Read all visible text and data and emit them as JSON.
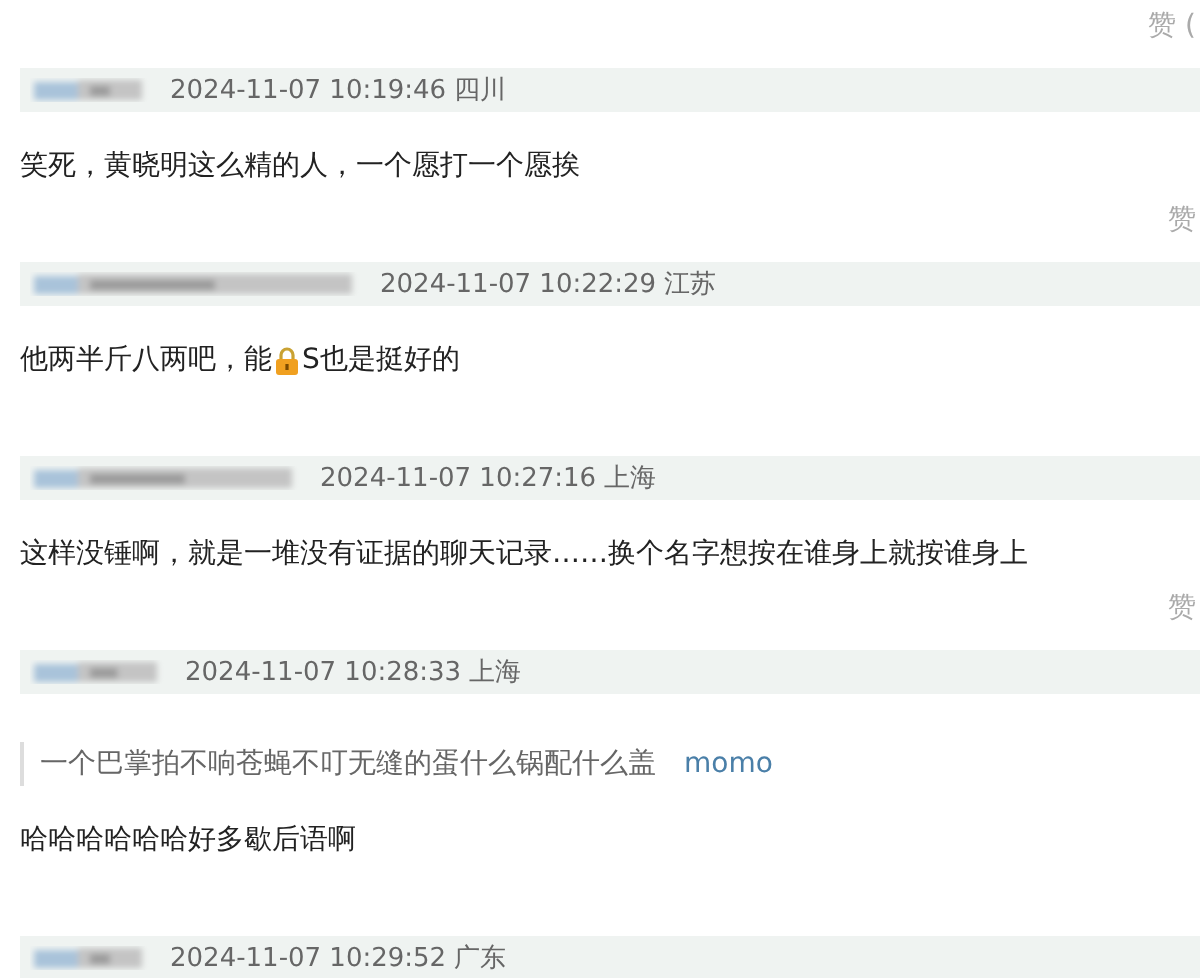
{
  "top_like": "赞 (",
  "comments": [
    {
      "time": "2024-11-07 10:19:46 四川",
      "text_parts": [
        "笑死，黄晓明这么精的人，一个愿打一个愿挨"
      ],
      "like": "赞"
    },
    {
      "time": "2024-11-07 10:22:29 江苏",
      "text_parts": [
        "他两半斤八两吧，能",
        "S也是挺好的"
      ]
    },
    {
      "time": "2024-11-07 10:27:16 上海",
      "text_parts": [
        "这样没锤啊，就是一堆没有证据的聊天记录……换个名字想按在谁身上就按谁身上"
      ],
      "like": "赞"
    },
    {
      "time": "2024-11-07 10:28:33 上海",
      "quote": {
        "text": "一个巴掌拍不响苍蝇不叮无缝的蛋什么锅配什么盖",
        "author": "momo"
      },
      "text_parts": [
        "哈哈哈哈哈哈好多歇后语啊"
      ]
    },
    {
      "time": "2024-11-07 10:29:52 广东"
    }
  ]
}
